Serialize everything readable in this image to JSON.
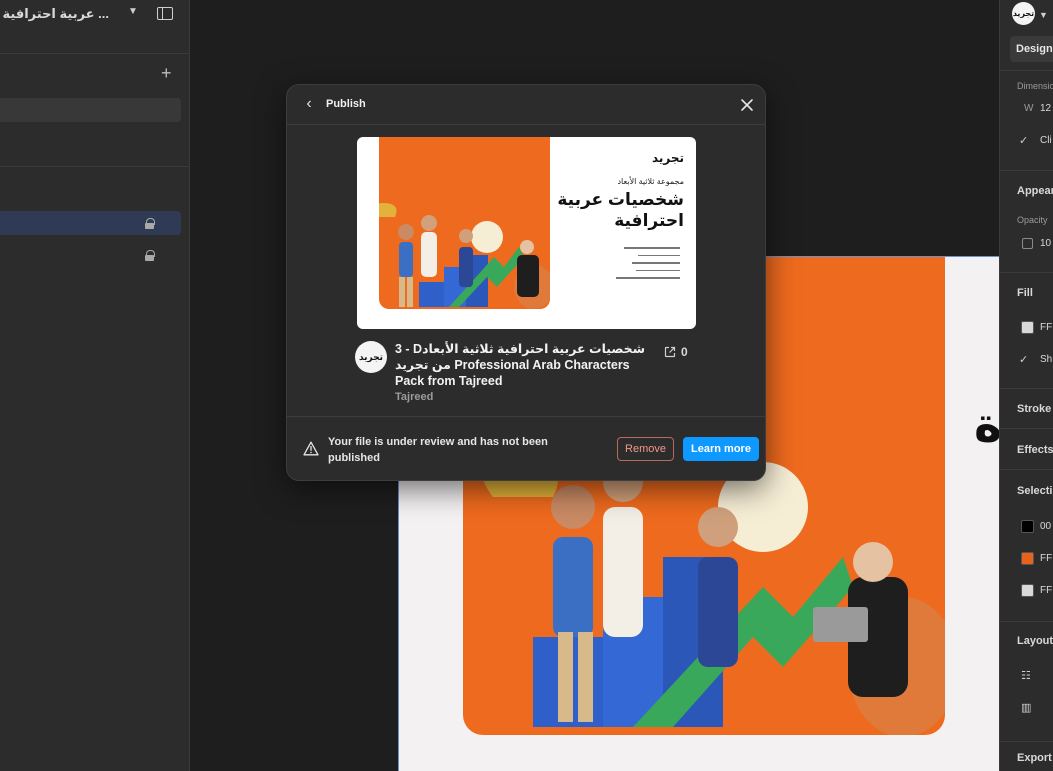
{
  "left_panel": {
    "file_title": "... عربية احترافية ثلاثية",
    "chevron_icon": "chevron-down-icon",
    "sidebar_toggle_icon": "sidebar-toggle-icon",
    "add_page_icon": "plus-icon"
  },
  "canvas": {
    "partial_heading": "ة"
  },
  "right_panel": {
    "avatar_label": "تجريد",
    "design_tab": "Design",
    "dimensions_label": "Dimensions",
    "width_prefix": "W",
    "width_value": "12",
    "clip_label": "Cli",
    "appearance_label": "Appear",
    "opacity_label": "Opacity",
    "opacity_value": "10",
    "fill_label": "Fill",
    "fill_value": "FF",
    "fill_show_label": "Sh",
    "stroke_label": "Stroke",
    "effects_label": "Effects",
    "selection_label": "Selecti",
    "selection_colors": [
      {
        "label": "00",
        "color": "#000000"
      },
      {
        "label": "FF",
        "color": "#e8621a"
      },
      {
        "label": "FF",
        "color": "#d9d9d9"
      }
    ],
    "layout_label": "Layout",
    "export_label": "Export"
  },
  "modal": {
    "title": "Publish",
    "back_icon": "chevron-left-icon",
    "close_icon": "close-icon",
    "thumbnail": {
      "logo": "تجريد",
      "subtitle": "مجموعة ثلاثية الأبعاد",
      "title": "شخصيات عربية احترافية"
    },
    "file": {
      "avatar_label": "تجريد",
      "title": "3 - Dشخصيات عربية احترافية ثلاثية الأبعاد من تجريد Professional Arab Characters Pack from Tajreed",
      "author": "Tajreed",
      "duplicate_count": "0",
      "duplicate_icon": "external-link-icon"
    },
    "footer": {
      "warning_icon": "warning-icon",
      "message": "Your file is under review and has not been published",
      "remove_label": "Remove",
      "learn_more_label": "Learn more"
    }
  }
}
